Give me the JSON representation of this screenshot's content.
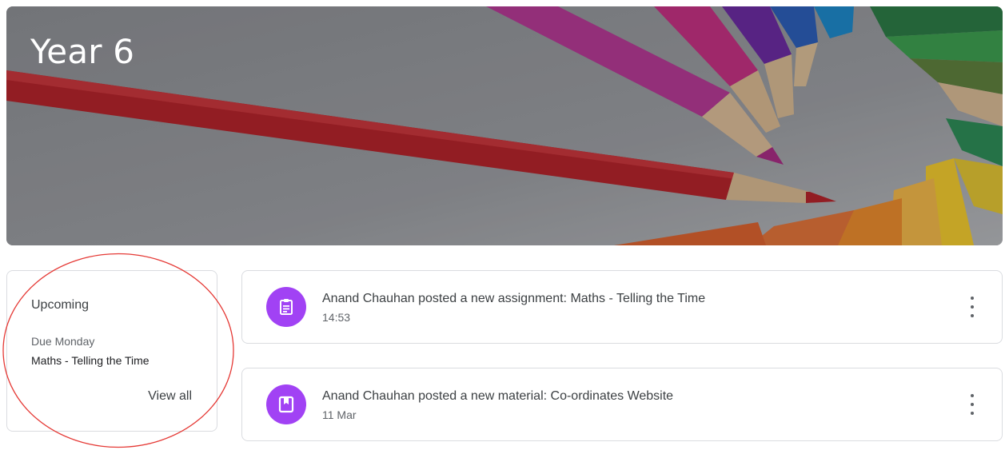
{
  "banner": {
    "title": "Year 6"
  },
  "upcoming": {
    "title": "Upcoming",
    "due_label": "Due Monday",
    "item": "Maths - Telling the Time",
    "view_all": "View all"
  },
  "stream": {
    "posts": [
      {
        "text": "Anand Chauhan posted a new assignment: Maths - Telling the Time",
        "time": "14:53",
        "icon": "assignment-icon"
      },
      {
        "text": "Anand Chauhan posted a new material: Co-ordinates Website",
        "time": "11 Mar",
        "icon": "material-icon"
      }
    ]
  },
  "colors": {
    "accent": "#a142f4",
    "annotation": "#e53935"
  }
}
